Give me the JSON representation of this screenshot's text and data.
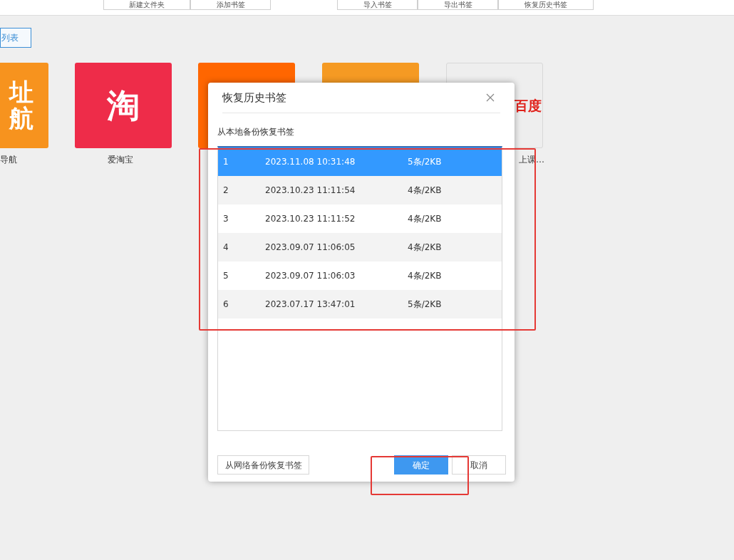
{
  "toolbar": {
    "buttons": [
      "新建文件夹",
      "添加书签",
      "导入书签",
      "导出书签",
      "恢复历史书签"
    ]
  },
  "view_button": "列表",
  "tiles": [
    {
      "logo": "址航",
      "label": "导航",
      "color": "#f7931e",
      "kind": "text"
    },
    {
      "logo": "淘",
      "label": "爱淘宝",
      "color": "#ee2c49",
      "kind": "text"
    },
    {
      "color": "#ff6600",
      "kind": "plain"
    },
    {
      "color": "#f59a23",
      "kind": "plain"
    },
    {
      "logo": "百度",
      "label": "上课…",
      "color": "#eeeeee",
      "kind": "outlined"
    }
  ],
  "dialog": {
    "title": "恢复历史书签",
    "subtitle": "从本地备份恢复书签",
    "rows": [
      {
        "index": "1",
        "time": "2023.11.08 10:31:48",
        "size": "5条/2KB",
        "selected": true
      },
      {
        "index": "2",
        "time": "2023.10.23 11:11:54",
        "size": "4条/2KB",
        "selected": false
      },
      {
        "index": "3",
        "time": "2023.10.23 11:11:52",
        "size": "4条/2KB",
        "selected": false
      },
      {
        "index": "4",
        "time": "2023.09.07 11:06:05",
        "size": "4条/2KB",
        "selected": false
      },
      {
        "index": "5",
        "time": "2023.09.07 11:06:03",
        "size": "4条/2KB",
        "selected": false
      },
      {
        "index": "6",
        "time": "2023.07.17 13:47:01",
        "size": "5条/2KB",
        "selected": false
      }
    ],
    "network_button": "从网络备份恢复书签",
    "ok_button": "确定",
    "cancel_button": "取消"
  }
}
